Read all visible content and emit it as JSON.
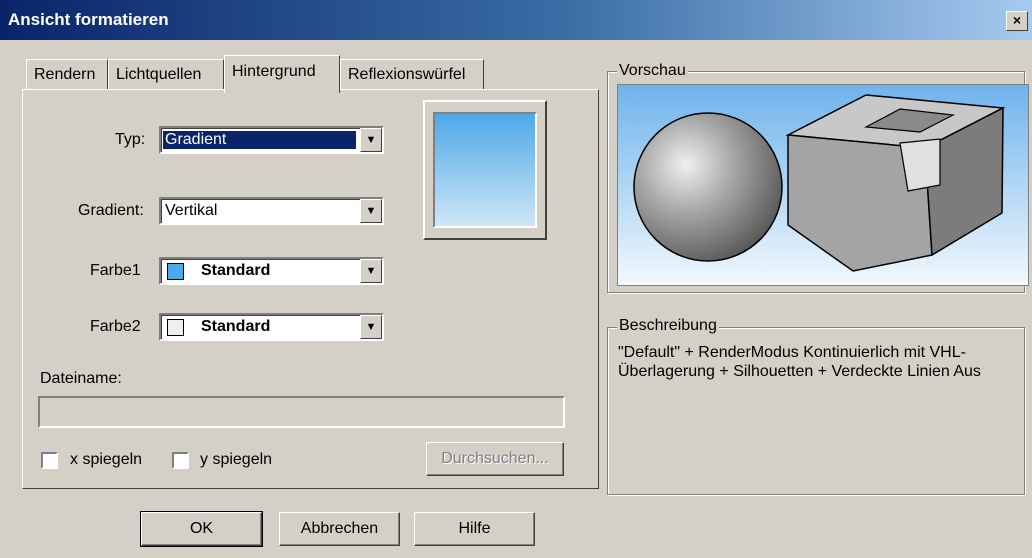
{
  "window": {
    "title": "Ansicht formatieren",
    "close_glyph": "×"
  },
  "tabs": [
    {
      "label": "Rendern"
    },
    {
      "label": "Lichtquellen"
    },
    {
      "label": "Hintergrund",
      "active": true
    },
    {
      "label": "Reflexionswürfel"
    }
  ],
  "form": {
    "typ_label": "Typ:",
    "typ_value": "Gradient",
    "gradient_label": "Gradient:",
    "gradient_value": "Vertikal",
    "farbe1_label": "Farbe1",
    "farbe1_value": "Standard",
    "farbe1_color": "#4aa8f0",
    "farbe2_label": "Farbe2",
    "farbe2_value": "Standard",
    "farbe2_color": "#efefef",
    "dateiname_label": "Dateiname:",
    "dateiname_value": "",
    "x_spiegeln_label": "x spiegeln",
    "y_spiegeln_label": "y spiegeln",
    "browse_label": "Durchsuchen..."
  },
  "preview": {
    "legend": "Vorschau"
  },
  "description": {
    "legend": "Beschreibung",
    "text": "\"Default\" + RenderModus Kontinuierlich mit VHL-Überlagerung + Silhouetten + Verdeckte Linien Aus"
  },
  "buttons": {
    "ok": "OK",
    "cancel": "Abbrechen",
    "help": "Hilfe"
  }
}
